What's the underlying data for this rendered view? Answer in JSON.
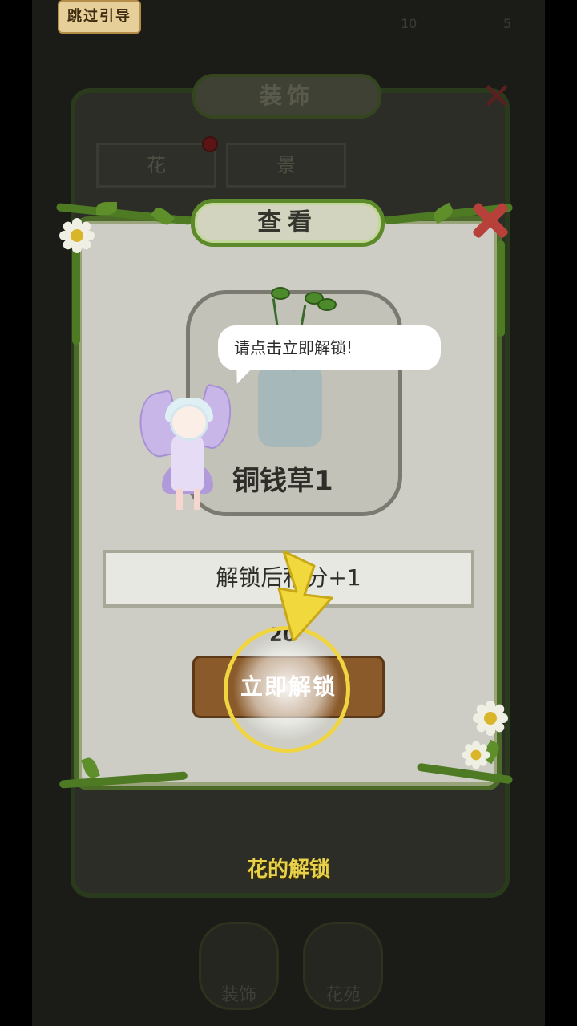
{
  "skip_button": {
    "label": "跳过引导"
  },
  "background": {
    "top_stats": [
      "10",
      "5"
    ],
    "title": "装饰",
    "tabs": [
      {
        "label": "花"
      },
      {
        "label": "景"
      }
    ],
    "bottom_buttons": [
      {
        "label": "装饰"
      },
      {
        "label": "花苑"
      }
    ]
  },
  "dialog": {
    "title": "查看",
    "plant_name": "铜钱草1",
    "bonus_text": "解锁后积分+1",
    "cost": "20",
    "unlock_button": "立即解锁"
  },
  "guide": {
    "speech": "请点击立即解锁!",
    "caption": "花的解锁"
  },
  "colors": {
    "caption_yellow": "#e9d24a",
    "button_brown": "#8a5a2a",
    "close_red": "#b8403a",
    "vine_green": "#4e7a24",
    "highlight_ring": "#f0d440"
  },
  "icons": [
    "close-icon",
    "pointer-arrow-icon",
    "fairy-guide-character",
    "daisy-flower-icon",
    "plant-vase-icon"
  ]
}
